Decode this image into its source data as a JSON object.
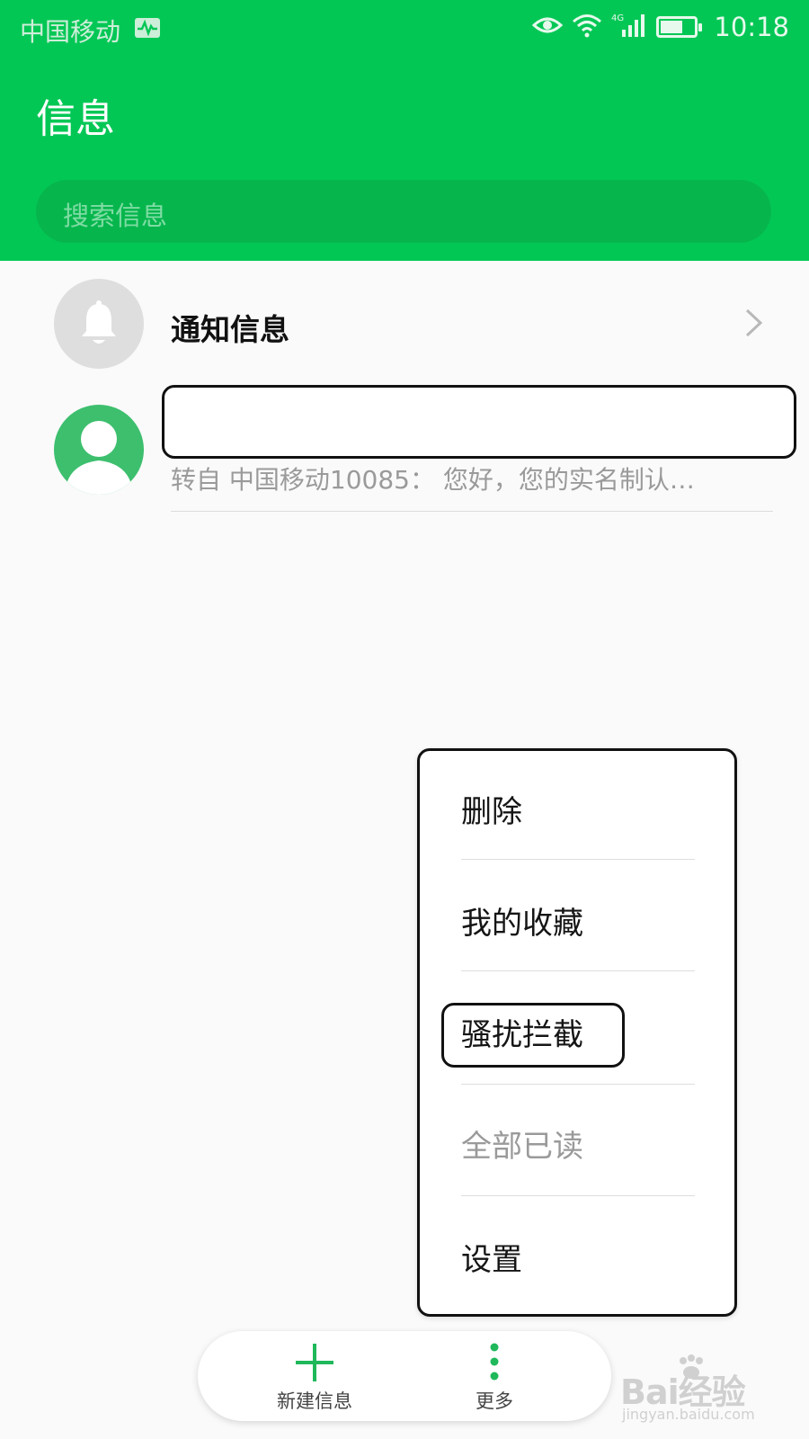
{
  "status_bar": {
    "carrier": "中国移动",
    "network": "4G",
    "time": "10:18"
  },
  "header": {
    "title": "信息",
    "search_placeholder": "搜索信息"
  },
  "conversations": [
    {
      "title": "通知信息",
      "icon": "bell-icon"
    },
    {
      "preview": "转自 中国移动10085： 您好，您的实名制认…",
      "icon": "contact-avatar-icon"
    }
  ],
  "menu": {
    "items": [
      {
        "label": "删除",
        "enabled": true
      },
      {
        "label": "我的收藏",
        "enabled": true
      },
      {
        "label": "骚扰拦截",
        "enabled": true
      },
      {
        "label": "全部已读",
        "enabled": false
      },
      {
        "label": "设置",
        "enabled": true
      }
    ]
  },
  "bottom_bar": {
    "new_message_label": "新建信息",
    "more_label": "更多"
  },
  "watermark": {
    "brand": "Bai经验",
    "url": "jingyan.baidu.com"
  },
  "colors": {
    "accent": "#03c755",
    "search_bg": "#06b64d"
  }
}
